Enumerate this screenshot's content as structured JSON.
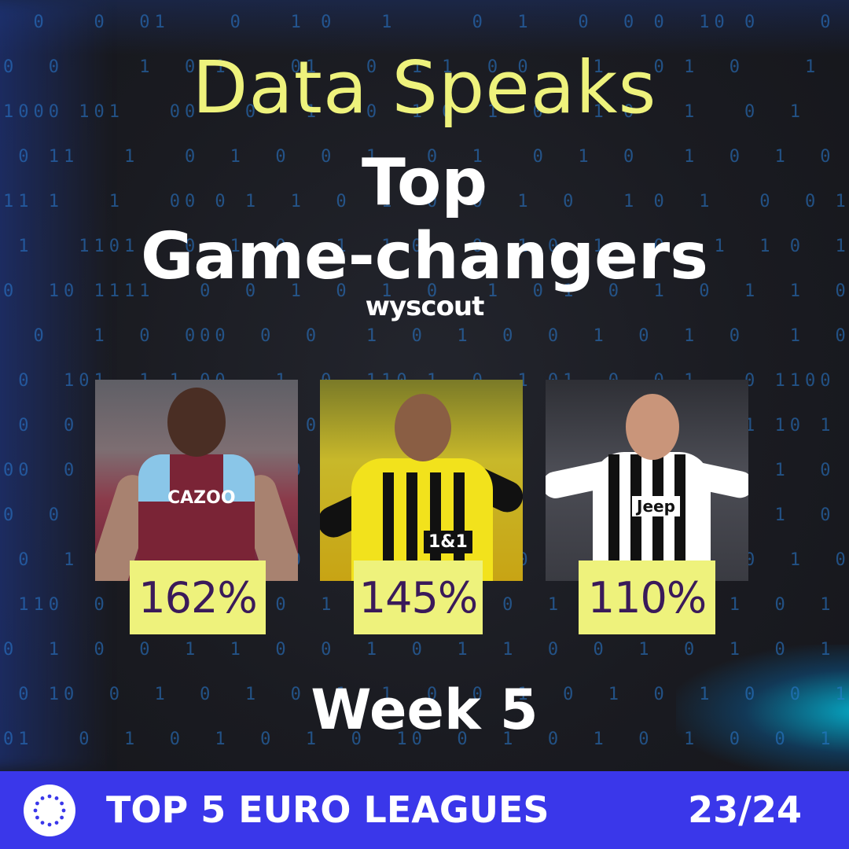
{
  "header": {
    "title": "Data Speaks",
    "subtitle_line1": "Top",
    "subtitle_line2": "Game-changers",
    "brand": "wyscout"
  },
  "players": [
    {
      "stat": "162%",
      "kit": "Aston Villa",
      "kit_text": "CAZOO"
    },
    {
      "stat": "145%",
      "kit": "Borussia Dortmund",
      "kit_text": "1&1"
    },
    {
      "stat": "110%",
      "kit": "Juventus",
      "kit_text": "Jeep"
    }
  ],
  "week_label": "Week 5",
  "footer": {
    "badge_icon": "eu-stars-icon",
    "label": "TOP 5 EURO LEAGUES",
    "season": "23/24"
  },
  "colors": {
    "accent_yellow": "#eef27c",
    "stat_text": "#3a1a5a",
    "footer_bg": "#3a37ea",
    "binary_blue": "#2b7fd8"
  }
}
